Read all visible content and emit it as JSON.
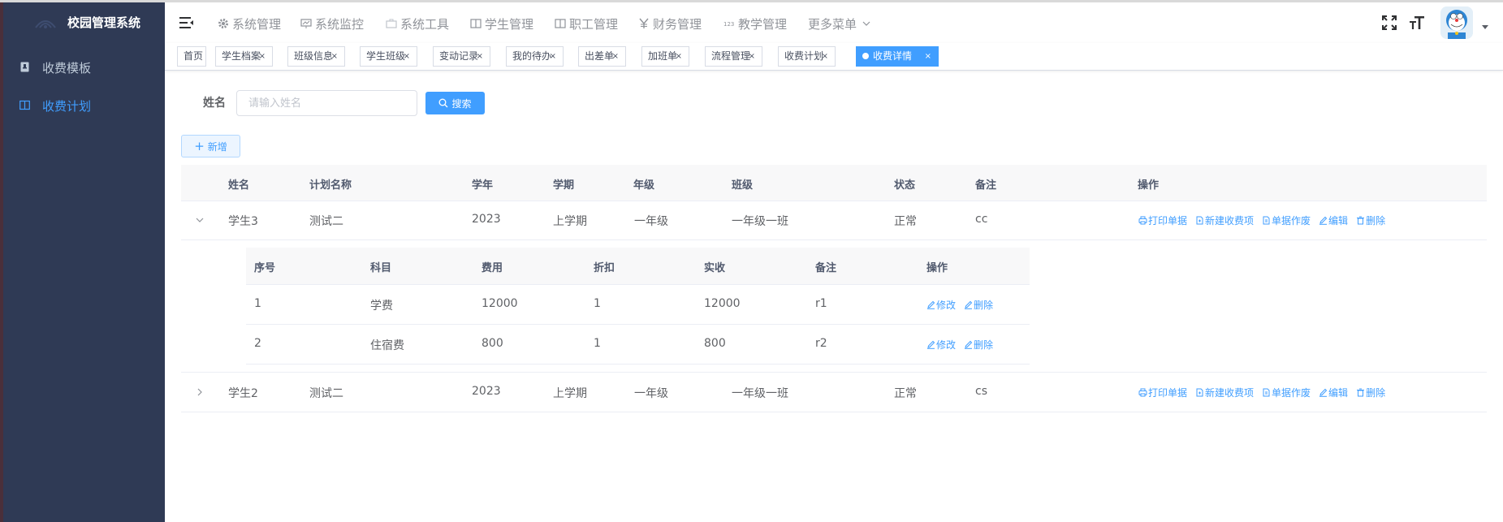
{
  "app": {
    "title": "校园管理系统"
  },
  "sidebar": {
    "items": [
      {
        "label": "收费模板",
        "active": false
      },
      {
        "label": "收费计划",
        "active": true
      }
    ]
  },
  "topnav": {
    "items": [
      {
        "label": "系统管理",
        "icon": "gear-icon"
      },
      {
        "label": "系统监控",
        "icon": "monitor-icon"
      },
      {
        "label": "系统工具",
        "icon": "toolbox-icon"
      },
      {
        "label": "学生管理",
        "icon": "book-icon"
      },
      {
        "label": "职工管理",
        "icon": "book-icon"
      },
      {
        "label": "财务管理",
        "icon": "yen-icon"
      },
      {
        "label": "教学管理",
        "icon": "number-icon"
      },
      {
        "label": "更多菜单",
        "icon": "chevron-down-icon"
      }
    ]
  },
  "tags": [
    {
      "label": "首页",
      "closable": false,
      "active": false
    },
    {
      "label": "学生档案",
      "closable": true,
      "active": false
    },
    {
      "label": "班级信息",
      "closable": true,
      "active": false
    },
    {
      "label": "学生班级",
      "closable": true,
      "active": false
    },
    {
      "label": "变动记录",
      "closable": true,
      "active": false
    },
    {
      "label": "我的待办",
      "closable": true,
      "active": false
    },
    {
      "label": "出差单",
      "closable": true,
      "active": false
    },
    {
      "label": "加班单",
      "closable": true,
      "active": false
    },
    {
      "label": "流程管理",
      "closable": true,
      "active": false
    },
    {
      "label": "收费计划",
      "closable": true,
      "active": false
    },
    {
      "label": "收费详情",
      "closable": true,
      "active": true
    }
  ],
  "close_glyph": "×",
  "search": {
    "label": "姓名",
    "placeholder": "请输入姓名",
    "value": "",
    "button_label": "搜索"
  },
  "toolbar": {
    "add_label": "新增"
  },
  "table": {
    "columns": [
      "姓名",
      "计划名称",
      "学年",
      "学期",
      "年级",
      "班级",
      "状态",
      "备注",
      "操作"
    ],
    "rows": [
      {
        "expanded": true,
        "name": "学生3",
        "plan": "测试二",
        "year": "2023",
        "term": "上学期",
        "grade": "一年级",
        "class": "一年级一班",
        "status": "正常",
        "note": "cc"
      },
      {
        "expanded": false,
        "name": "学生2",
        "plan": "测试二",
        "year": "2023",
        "term": "上学期",
        "grade": "一年级",
        "class": "一年级一班",
        "status": "正常",
        "note": "cs"
      }
    ],
    "row_actions": [
      "打印单据",
      "新建收费项",
      "单据作废",
      "编辑",
      "删除"
    ]
  },
  "subtable": {
    "columns": [
      "序号",
      "科目",
      "费用",
      "折扣",
      "实收",
      "备注",
      "操作"
    ],
    "rows": [
      {
        "index": "1",
        "subject": "学费",
        "fee": "12000",
        "discount": "1",
        "received": "12000",
        "note": "r1"
      },
      {
        "index": "2",
        "subject": "住宿费",
        "fee": "800",
        "discount": "1",
        "received": "800",
        "note": "r2"
      }
    ],
    "row_actions": [
      "修改",
      "删除"
    ]
  },
  "colors": {
    "primary": "#409eff",
    "sidebar_bg": "#2f3a55",
    "sidebar_text": "#bfcbd9"
  }
}
